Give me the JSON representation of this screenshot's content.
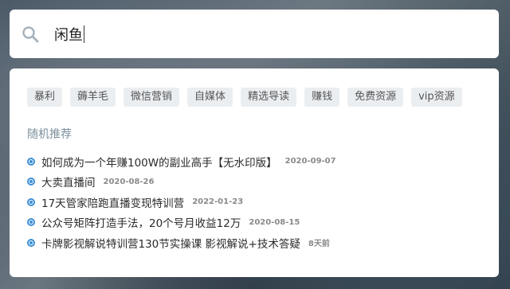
{
  "search": {
    "value": "闲鱼"
  },
  "tags": [
    "暴利",
    "薅羊毛",
    "微信营销",
    "自媒体",
    "精选导读",
    "赚钱",
    "免费资源",
    "vip资源"
  ],
  "section_title": "随机推荐",
  "items": [
    {
      "title": "如何成为一个年赚100W的副业高手【无水印版】",
      "date": "2020-09-07"
    },
    {
      "title": "大卖直播间",
      "date": "2020-08-26"
    },
    {
      "title": "17天管家陪跑直播变现特训营",
      "date": "2022-01-23"
    },
    {
      "title": "公众号矩阵打造手法，20个号月收益12万",
      "date": "2020-08-15"
    },
    {
      "title": "卡牌影视解说特训营130节实操课 影视解说+技术答疑",
      "date": "8天前"
    }
  ],
  "colors": {
    "accent": "#3c8fd6",
    "tag_bg": "#ebeef1",
    "section_title": "#7b8f9d"
  }
}
